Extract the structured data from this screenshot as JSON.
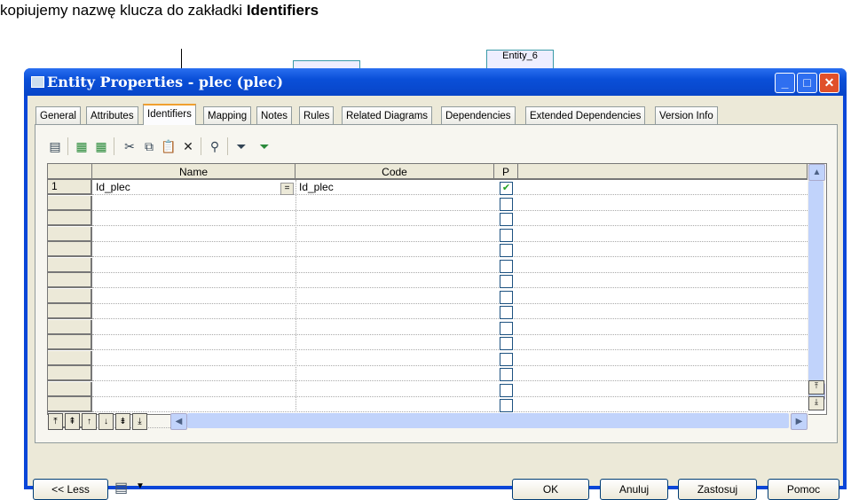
{
  "caption": {
    "text": "kopiujemy nazwę klucza do zakładki ",
    "bold": "Identifiers"
  },
  "background": {
    "entity_label": "Entity_6"
  },
  "window": {
    "title": "Entity Properties - plec (plec)",
    "minimize": "_",
    "maximize": "□",
    "close": "✕"
  },
  "tabs": [
    "General",
    "Attributes",
    "Identifiers",
    "Mapping",
    "Notes",
    "Rules",
    "Related Diagrams",
    "Dependencies",
    "Extended Dependencies",
    "Version Info"
  ],
  "active_tab": "Identifiers",
  "toolbar_icons": [
    "properties-icon",
    "insert-row-icon",
    "add-row-icon",
    "cut-icon",
    "copy-icon",
    "paste-icon",
    "delete-icon",
    "find-icon",
    "filter-icon",
    "filter-check-icon"
  ],
  "grid": {
    "columns": [
      "Name",
      "Code",
      "P"
    ],
    "rows": [
      {
        "num": "1",
        "name": "Id_plec",
        "code": "Id_plec",
        "primary": true
      }
    ],
    "empty_rows": 15,
    "ellipsis_button": "="
  },
  "buttons": {
    "less": "<< Less",
    "ok": "OK",
    "cancel": "Anuluj",
    "apply": "Zastosuj",
    "help": "Pomoc"
  },
  "colors": {
    "titlebar": "#0a4fd8",
    "active_tab_accent": "#f0a030",
    "check": "#21a121"
  }
}
